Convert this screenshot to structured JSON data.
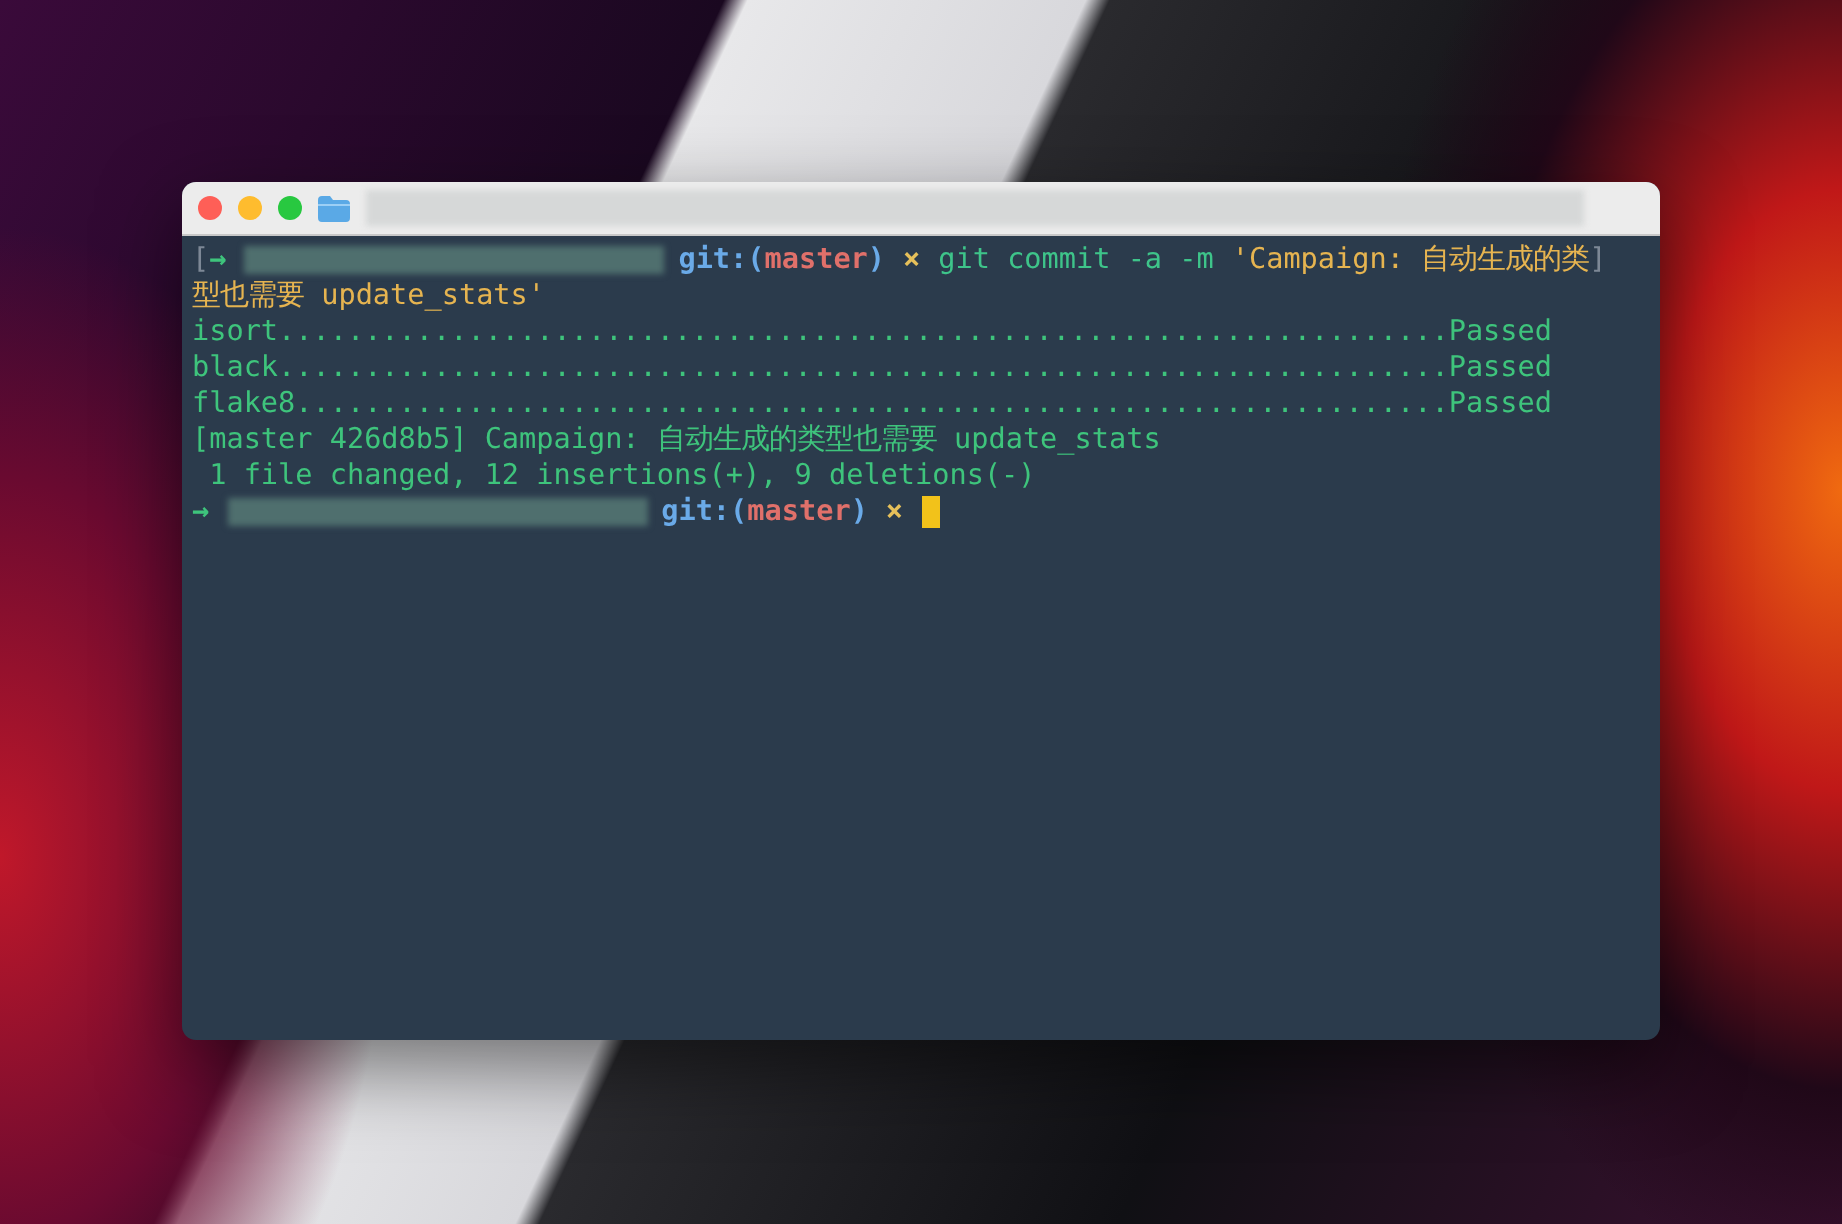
{
  "terminal": {
    "lines": [
      {
        "segments": [
          {
            "kind": "mark",
            "text": "["
          },
          {
            "kind": "arrow",
            "text": "→"
          },
          {
            "kind": "redacted"
          },
          {
            "kind": "git",
            "text": "git:("
          },
          {
            "kind": "branch",
            "text": "master"
          },
          {
            "kind": "git",
            "text": ")"
          },
          {
            "kind": "dirty",
            "text": "×"
          },
          {
            "kind": "command",
            "text": "git commit -a -m"
          },
          {
            "kind": "string",
            "text": "'Campaign: 自动生成的类"
          },
          {
            "kind": "mark",
            "text": "]"
          }
        ]
      },
      {
        "segments": [
          {
            "kind": "string",
            "text": "型也需要 update_stats'"
          }
        ]
      },
      {
        "segments": [
          {
            "kind": "output",
            "text": "isort....................................................................Passed"
          }
        ]
      },
      {
        "segments": [
          {
            "kind": "output",
            "text": "black....................................................................Passed"
          }
        ]
      },
      {
        "segments": [
          {
            "kind": "output",
            "text": "flake8...................................................................Passed"
          }
        ]
      },
      {
        "segments": [
          {
            "kind": "output",
            "text": "[master 426d8b5] Campaign: 自动生成的类型也需要 update_stats"
          }
        ]
      },
      {
        "segments": [
          {
            "kind": "output",
            "text": " 1 file changed, 12 insertions(+), 9 deletions(-)"
          }
        ]
      },
      {
        "segments": [
          {
            "kind": "arrow",
            "text": "→"
          },
          {
            "kind": "redacted"
          },
          {
            "kind": "git",
            "text": "git:("
          },
          {
            "kind": "branch",
            "text": "master"
          },
          {
            "kind": "git",
            "text": ")"
          },
          {
            "kind": "dirty",
            "text": "×"
          },
          {
            "kind": "cursor"
          }
        ]
      }
    ]
  }
}
